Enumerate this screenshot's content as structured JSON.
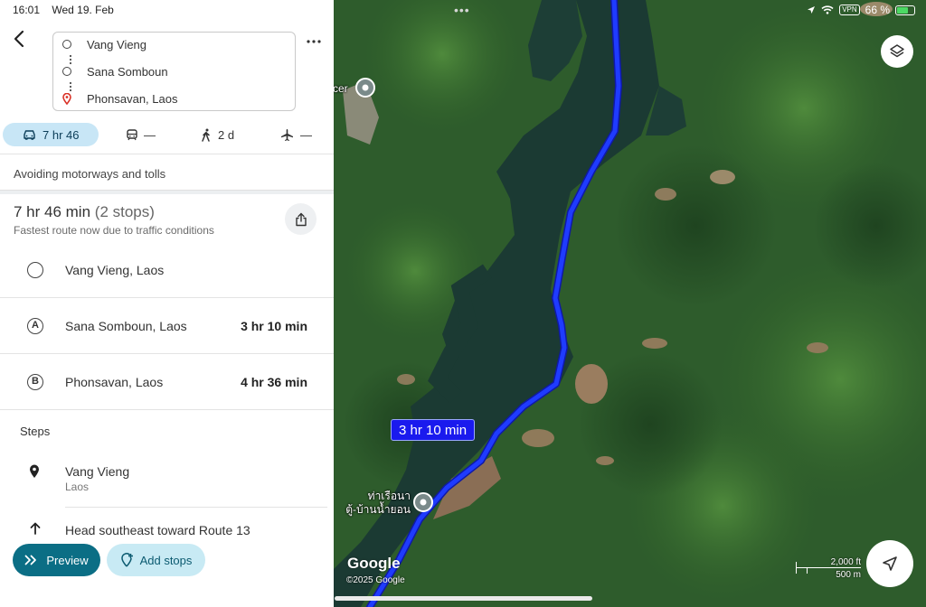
{
  "status_bar": {
    "time": "16:01",
    "date": "Wed 19. Feb",
    "vpn": "VPN",
    "battery": "66 %"
  },
  "waypoints": [
    {
      "label": "Vang Vieng"
    },
    {
      "label": "Sana Somboun"
    },
    {
      "label": "Phonsavan, Laos"
    }
  ],
  "modes": {
    "drive": "7 hr 46",
    "transit": "—",
    "walk": "2 d",
    "flight": "—"
  },
  "route_options": {
    "avoid": "Avoiding motorways and tolls"
  },
  "summary": {
    "duration": "7 hr 46 min",
    "stops": "(2 stops)",
    "note": "Fastest route now due to traffic conditions"
  },
  "stops": [
    {
      "marker": "",
      "name": "Vang Vieng, Laos",
      "duration": ""
    },
    {
      "marker": "A",
      "name": "Sana Somboun, Laos",
      "duration": "3 hr 10 min"
    },
    {
      "marker": "B",
      "name": "Phonsavan, Laos",
      "duration": "4 hr 36 min"
    }
  ],
  "steps": {
    "title": "Steps",
    "items": [
      {
        "title": "Vang Vieng",
        "subtitle": "Laos"
      },
      {
        "title": "Head southeast toward Route 13"
      }
    ]
  },
  "buttons": {
    "preview": "Preview",
    "add_stops": "Add stops"
  },
  "map": {
    "route_badge": "3 hr 10 min",
    "place_top": "cer",
    "place_bottom_line1": "ท่าเรือนา",
    "place_bottom_line2": "ตู้-บ้านน้ำยอน",
    "logo": "Google",
    "copyright": "©2025 Google",
    "scale_imperial": "2,000 ft",
    "scale_metric": "500 m",
    "route_color": "#1a2bff"
  }
}
